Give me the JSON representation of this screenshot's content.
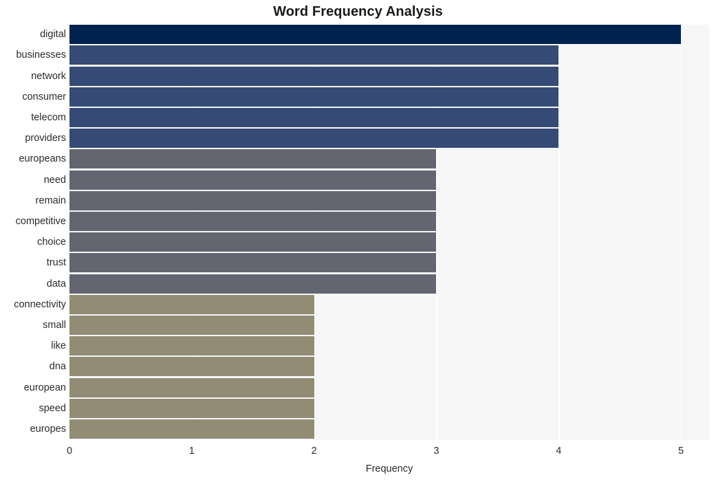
{
  "chart_data": {
    "type": "bar",
    "orientation": "horizontal",
    "title": "Word Frequency Analysis",
    "xlabel": "Frequency",
    "ylabel": "",
    "xlim": [
      0,
      5.23
    ],
    "xticks": [
      0,
      1,
      2,
      3,
      4,
      5
    ],
    "xtick_labels": [
      "0",
      "1",
      "2",
      "3",
      "4",
      "5"
    ],
    "grid": "vertical-white-on-light-background",
    "legend": "none",
    "categories": [
      "digital",
      "businesses",
      "network",
      "consumer",
      "telecom",
      "providers",
      "europeans",
      "need",
      "remain",
      "competitive",
      "choice",
      "trust",
      "data",
      "connectivity",
      "small",
      "like",
      "dna",
      "european",
      "speed",
      "europes"
    ],
    "values": [
      5,
      4,
      4,
      4,
      4,
      4,
      3,
      3,
      3,
      3,
      3,
      3,
      3,
      2,
      2,
      2,
      2,
      2,
      2,
      2
    ],
    "bar_colors": [
      "#00224e",
      "#354a75",
      "#354a75",
      "#354a75",
      "#354a75",
      "#354a75",
      "#636670",
      "#636670",
      "#636670",
      "#636670",
      "#636670",
      "#636670",
      "#636670",
      "#918c73",
      "#918c73",
      "#918c73",
      "#918c73",
      "#918c73",
      "#918c73",
      "#918c73"
    ]
  },
  "style": {
    "plot_background": "#f6f6f7",
    "figure_background": "#ffffff",
    "gridline_color": "#ffffff",
    "text_color": "#2b2b2b",
    "title_color": "#1a1a1a"
  }
}
